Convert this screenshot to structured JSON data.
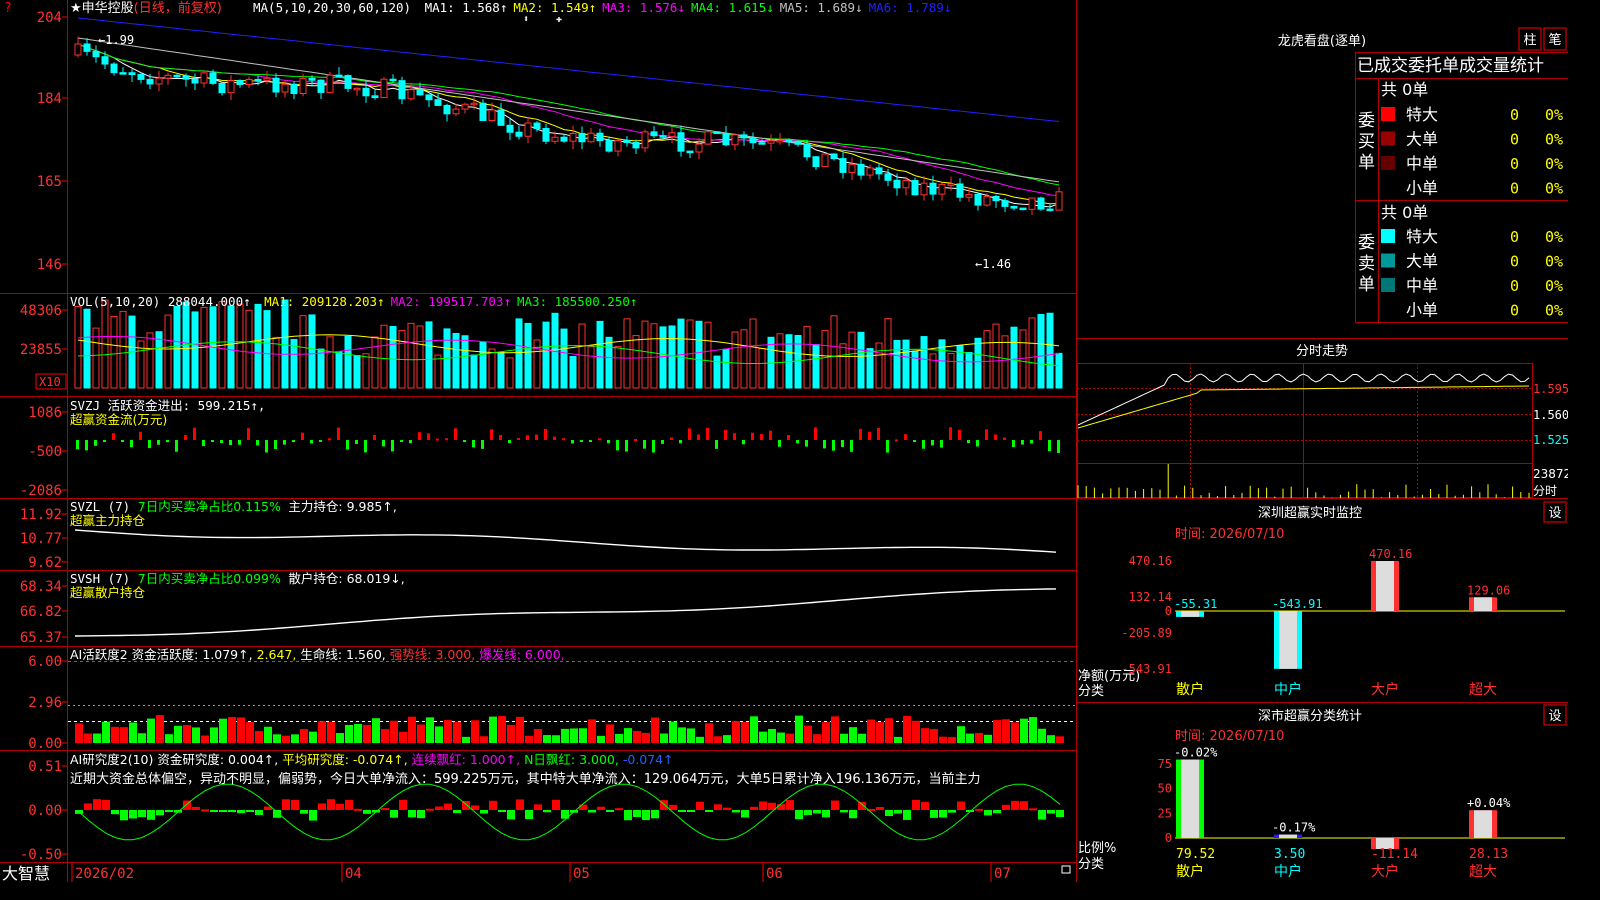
{
  "stock": {
    "title": "★申华控股",
    "period": "(日线，前复权)",
    "ma_label": "MA(5,10,20,30,60,120)",
    "ma_values": [
      {
        "text": "MA1: 1.568↑",
        "color": "#ffffff"
      },
      {
        "text": "MA2: 1.549↑",
        "color": "#ffff00"
      },
      {
        "text": "MA3: 1.576↓",
        "color": "#ff00ff"
      },
      {
        "text": "MA4: 1.615↓",
        "color": "#00ff00"
      },
      {
        "text": "MA5: 1.689↓",
        "color": "#c0c0c0"
      },
      {
        "text": "MA6: 1.789↓",
        "color": "#2020ff"
      }
    ],
    "high_note": "1.99",
    "low_note": "1.46",
    "price_axis": [
      "204",
      "184",
      "165",
      "146"
    ]
  },
  "volume": {
    "header": "VOL(5,10,20) 288044.000↑",
    "ma": [
      {
        "text": "MA1: 209128.203↑",
        "color": "#ffff00"
      },
      {
        "text": "MA2: 199517.703↑",
        "color": "#ff00ff"
      },
      {
        "text": "MA3: 185500.250↑",
        "color": "#00ff00"
      }
    ],
    "axis": [
      "48306",
      "23855"
    ],
    "unit": "X10"
  },
  "svzj": {
    "header": "SVZJ  活跃资金进出: 599.215↑,",
    "sub": "超赢资金流(万元)",
    "axis": [
      "1086",
      "-500",
      "-2086"
    ]
  },
  "svzl": {
    "header_a": "SVZL (7)",
    "header_b": "7日内买卖净占比0.115%",
    "header_c": "主力持仓: 9.985↑,",
    "sub": "超赢主力持仓",
    "axis": [
      "11.92",
      "10.77",
      "9.62"
    ]
  },
  "svsh": {
    "header_a": "SVSH (7)",
    "header_b": "7日内买卖净占比0.099%",
    "header_c": "散户持仓: 68.019↓,",
    "sub": "超赢散户持仓",
    "axis": [
      "68.34",
      "66.82",
      "65.37"
    ]
  },
  "ai_active": {
    "header_a": "AI活跃度2 资金活跃度: 1.079↑,",
    "header_b": "2.647,",
    "header_c": "生命线: 1.560,",
    "header_d": "强势线: 3.000,",
    "header_e": "爆发线: 6.000,",
    "axis": [
      "6.00",
      "2.96",
      "0.00"
    ]
  },
  "ai_research": {
    "header_a": "AI研究度2(10) 资金研究度: 0.004↑,",
    "header_b": "平均研究度: -0.074↑,",
    "header_c": "连续飘红: 1.000↑,",
    "header_d": "N日飘红: 3.000,",
    "header_e": "-0.074↑",
    "commentary": "近期大资金总体偏空，异动不明显，偏弱势，今日大单净流入：599.225万元，其中特大单净流入：129.064万元，大单5日累计净入196.136万元，当前主力",
    "axis": [
      "0.51",
      "0.00",
      "-0.50"
    ]
  },
  "date_axis": {
    "logo": "大智慧",
    "labels": [
      "2026/02",
      "04",
      "05",
      "06",
      "07"
    ]
  },
  "longhu": {
    "title": "龙虎看盘(逐单)",
    "tab_column": "柱",
    "tab_stroke": "笔",
    "subtitle": "已成交委托单成交量统计",
    "buy_label": "委买单",
    "sell_label": "委卖单",
    "buy_total": "共 0单",
    "sell_total": "共 0单",
    "buy_rows": [
      {
        "name": "特大",
        "count": "0",
        "pct": "0%",
        "color": "#ff0000"
      },
      {
        "name": "大单",
        "count": "0",
        "pct": "0%",
        "color": "#990000"
      },
      {
        "name": "中单",
        "count": "0",
        "pct": "0%",
        "color": "#660000"
      },
      {
        "name": "小单",
        "count": "0",
        "pct": "0%",
        "color": "#000000"
      }
    ],
    "sell_rows": [
      {
        "name": "特大",
        "count": "0",
        "pct": "0%",
        "color": "#00ffff"
      },
      {
        "name": "大单",
        "count": "0",
        "pct": "0%",
        "color": "#009999"
      },
      {
        "name": "中单",
        "count": "0",
        "pct": "0%",
        "color": "#007777"
      },
      {
        "name": "小单",
        "count": "0",
        "pct": "0%",
        "color": "#000000"
      }
    ]
  },
  "intraday": {
    "title": "分时走势",
    "price_axis": [
      "1.595",
      "1.560",
      "1.525"
    ],
    "vol_axis": [
      "23872",
      "分时"
    ]
  },
  "monitor": {
    "title": "深圳超赢实时监控",
    "setting": "设",
    "time": "时间: 2026/07/10",
    "unit_label": "净额(万元)",
    "cat_label": "分类",
    "axis": [
      "470.16",
      "132.14",
      "0",
      "-205.89",
      "-543.91"
    ],
    "categories": [
      "散户",
      "中户",
      "大户",
      "超大"
    ],
    "values": [
      -55.31,
      -543.91,
      470.16,
      129.06
    ],
    "value_labels": [
      "-55.31",
      "-543.91",
      "470.16",
      "129.06"
    ]
  },
  "classify": {
    "title": "深市超赢分类统计",
    "setting": "设",
    "time": "时间: 2026/07/10",
    "unit_label": "比例%",
    "cat_label": "分类",
    "axis": [
      "75",
      "50",
      "25",
      "0"
    ],
    "categories": [
      "散户",
      "中户",
      "大户",
      "超大"
    ],
    "values": [
      79.52,
      3.5,
      -11.14,
      28.13
    ],
    "value_labels": [
      "79.52",
      "3.50",
      "-11.14",
      "28.13"
    ],
    "change_labels": [
      "-0.02%",
      "-0.17%",
      "",
      "+0.04%"
    ]
  },
  "chart_data": [
    {
      "type": "candlestick",
      "title": "申华控股 (日线，前复权)",
      "x_range": [
        "2026/02",
        "2026/07/10"
      ],
      "price_ticks_printed": [
        "204",
        "184",
        "165",
        "146"
      ],
      "marked_high": 1.99,
      "marked_low": 1.46,
      "series": [
        {
          "name": "MA1",
          "last": 1.568
        },
        {
          "name": "MA2",
          "last": 1.549
        },
        {
          "name": "MA3",
          "last": 1.576
        },
        {
          "name": "MA4",
          "last": 1.615
        },
        {
          "name": "MA5",
          "last": 1.689
        },
        {
          "name": "MA6",
          "last": 1.789
        }
      ]
    },
    {
      "type": "bar",
      "title": "VOL(5,10,20)",
      "last": 288044.0,
      "series": [
        {
          "name": "MA1",
          "last": 209128.203
        },
        {
          "name": "MA2",
          "last": 199517.703
        },
        {
          "name": "MA3",
          "last": 185500.25
        }
      ],
      "y_ticks": [
        48306,
        23855
      ]
    },
    {
      "type": "bar",
      "title": "深圳超赢实时监控",
      "categories": [
        "散户",
        "中户",
        "大户",
        "超大"
      ],
      "values": [
        -55.31,
        -543.91,
        470.16,
        129.06
      ],
      "ylim": [
        -543.91,
        470.16
      ],
      "ylabel": "净额(万元)"
    },
    {
      "type": "bar",
      "title": "深市超赢分类统计",
      "categories": [
        "散户",
        "中户",
        "大户",
        "超大"
      ],
      "values": [
        79.52,
        3.5,
        -11.14,
        28.13
      ],
      "ylim": [
        0,
        75
      ],
      "ylabel": "比例%"
    }
  ]
}
